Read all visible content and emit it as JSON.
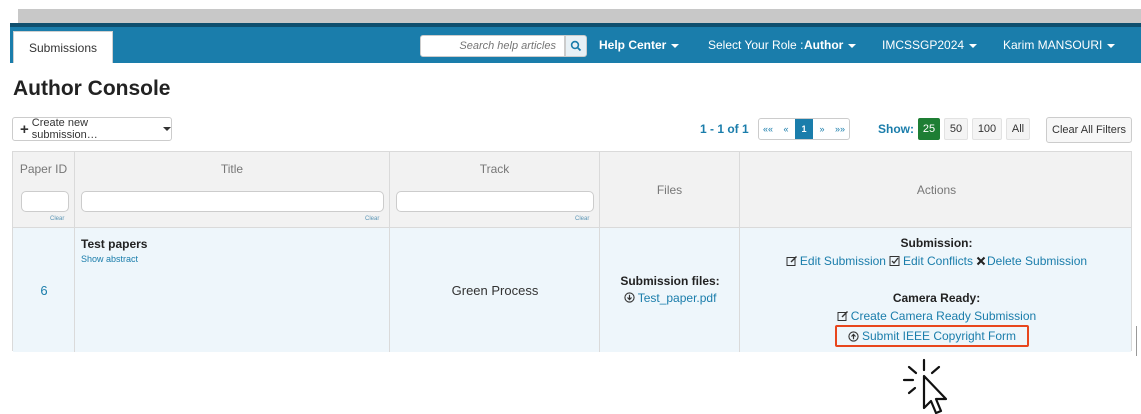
{
  "nav": {
    "tab": "Submissions",
    "search_placeholder": "Search help articles",
    "help_center": "Help Center",
    "role_label": "Select Your Role :",
    "role_value": "Author",
    "conference": "IMCSSGP2024",
    "user": "Karim MANSOURI",
    "bar_color": "#1a7dab"
  },
  "page": {
    "title": "Author Console",
    "create_button": "Create new submission…"
  },
  "pagination": {
    "summary": "1 - 1 of 1",
    "first": "««",
    "prev": "«",
    "current": "1",
    "next": "»",
    "last": "»»",
    "show_label": "Show:",
    "show_options": [
      "25",
      "50",
      "100",
      "All"
    ],
    "selected": "25",
    "clear_all": "Clear All Filters"
  },
  "table": {
    "columns": [
      "Paper ID",
      "Title",
      "Track",
      "Files",
      "Actions"
    ],
    "clear_label": "Clear",
    "row": {
      "paper_id": "6",
      "title": "Test papers",
      "show_abstract": "Show abstract",
      "track": "Green Process",
      "files_heading": "Submission files:",
      "file_name": "Test_paper.pdf",
      "submission_heading": "Submission:",
      "edit_submission": "Edit Submission",
      "edit_conflicts": "Edit Conflicts",
      "delete_submission": "Delete Submission",
      "camera_heading": "Camera Ready:",
      "create_camera_ready": "Create Camera Ready Submission",
      "copyright_form": "Submit IEEE Copyright Form"
    }
  },
  "colors": {
    "link": "#1a7dab",
    "highlight": "#e8461d",
    "show_active": "#1e7e34"
  }
}
